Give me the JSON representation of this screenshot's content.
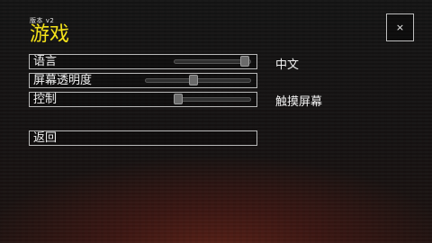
{
  "header": {
    "version": "版本 v2",
    "title": "游戏",
    "close_label": "×"
  },
  "settings": [
    {
      "label": "语言",
      "value": "中文",
      "slider_level": 0.97
    },
    {
      "label": "屏幕透明度",
      "value": "",
      "slider_level": 0.45
    },
    {
      "label": "控制",
      "value": "触摸屏幕",
      "slider_level": 0.0
    }
  ],
  "back_label": "返回",
  "colors": {
    "title": "#f4e21a",
    "border": "#b8b8b8",
    "slider_track": "#2e2e2e",
    "slider_thumb": "#6b6b6b"
  }
}
